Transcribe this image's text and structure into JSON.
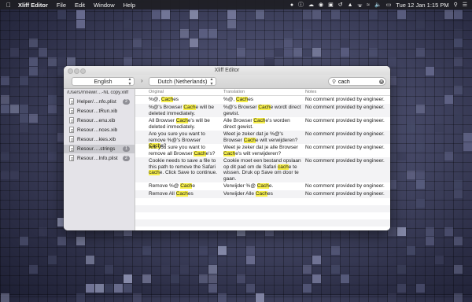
{
  "menubar": {
    "app_name": "Xliff Editor",
    "items": [
      "File",
      "Edit",
      "Window",
      "Help"
    ],
    "clock": "Tue 12 Jan  1:15 PM"
  },
  "window": {
    "title": "Xliff Editor"
  },
  "toolbar": {
    "source_language": "English",
    "target_language": "Dutch (Netherlands)",
    "search_value": "cach",
    "search_placeholder": "Search"
  },
  "sidebar": {
    "path": "/Users/mnewir…-NL copy.xliff",
    "files": [
      {
        "name": "Helper/…nfo.plist",
        "badge": "2",
        "selected": false
      },
      {
        "name": "Resour…tRun.xib",
        "badge": "",
        "selected": false
      },
      {
        "name": "Resour…enu.xib",
        "badge": "",
        "selected": false
      },
      {
        "name": "Resour…nces.xib",
        "badge": "",
        "selected": false
      },
      {
        "name": "Resour…kies.xib",
        "badge": "",
        "selected": false
      },
      {
        "name": "Resour….strings",
        "badge": "1",
        "selected": true
      },
      {
        "name": "Resour…Info.plist",
        "badge": "2",
        "selected": false
      }
    ]
  },
  "table": {
    "columns": [
      "Original",
      "Translation",
      "Notes"
    ],
    "highlight": "cach",
    "rows": [
      {
        "original": "%@, Caches",
        "translation": "%@, Caches",
        "notes": "No comment provided by engineer."
      },
      {
        "original": "%@'s Browser Cache will be deleted immediately.",
        "translation": "%@'s Browser Cache wordt direct gewist.",
        "notes": "No comment provided by engineer."
      },
      {
        "original": "All Browser Cache's will be deleted immediately.",
        "translation": "Alle Browser Cache's worden direct gewist.",
        "notes": "No comment provided by engineer."
      },
      {
        "original": "Are you sure you want to remove %@'s Browser Cache?",
        "translation": "Weet je zeker dat je %@'s Browser Cache wilt verwijderen?",
        "notes": "No comment provided by engineer."
      },
      {
        "original": "Are you sure you want to remove all Browser Cache's?",
        "translation": "Weet je zeker dat je alle Browser Cache's wilt verwijderen?",
        "notes": "No comment provided by engineer."
      },
      {
        "original": "Cookie needs to save a file to this path to remove the Safari cache. Click Save to continue.",
        "translation": "Cookie moet een bestand opslaan op dit pad om de Safari cache te wissen. Druk op Save om door te gaan.",
        "notes": "No comment provided by engineer."
      },
      {
        "original": "Remove %@ Cache",
        "translation": "Verwijder %@ Cache.",
        "notes": "No comment provided by engineer."
      },
      {
        "original": "Remove All Caches",
        "translation": "Verwijder Alle Caches",
        "notes": "No comment provided by engineer."
      }
    ]
  },
  "colors": {
    "highlight": "#f8f04a",
    "selection": "#c8c8cd",
    "sidebar": "#e4e3e8"
  }
}
